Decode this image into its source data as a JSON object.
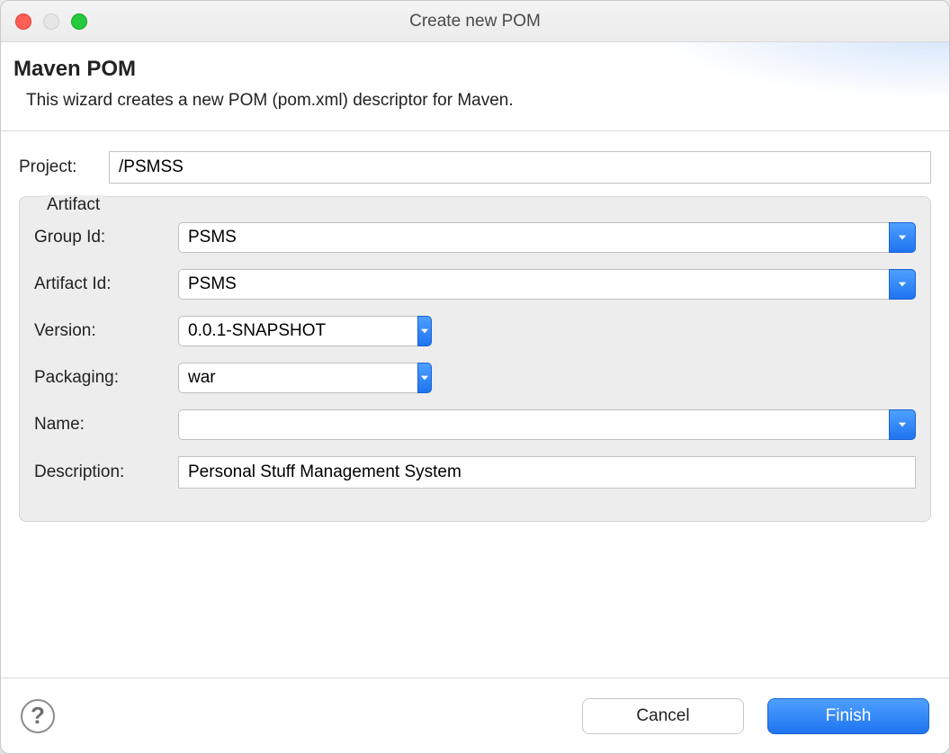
{
  "window": {
    "title": "Create new POM"
  },
  "header": {
    "title": "Maven POM",
    "description": "This wizard creates a new POM (pom.xml) descriptor for Maven."
  },
  "project": {
    "label": "Project:",
    "value": "/PSMSS"
  },
  "artifact": {
    "legend": "Artifact",
    "group_id": {
      "label": "Group Id:",
      "value": "PSMS"
    },
    "artifact_id": {
      "label": "Artifact Id:",
      "value": "PSMS"
    },
    "version": {
      "label": "Version:",
      "value": "0.0.1-SNAPSHOT"
    },
    "packaging": {
      "label": "Packaging:",
      "value": "war"
    },
    "name_field": {
      "label": "Name:",
      "value": ""
    },
    "description": {
      "label": "Description:",
      "value": "Personal Stuff Management System"
    }
  },
  "footer": {
    "cancel": "Cancel",
    "finish": "Finish"
  }
}
